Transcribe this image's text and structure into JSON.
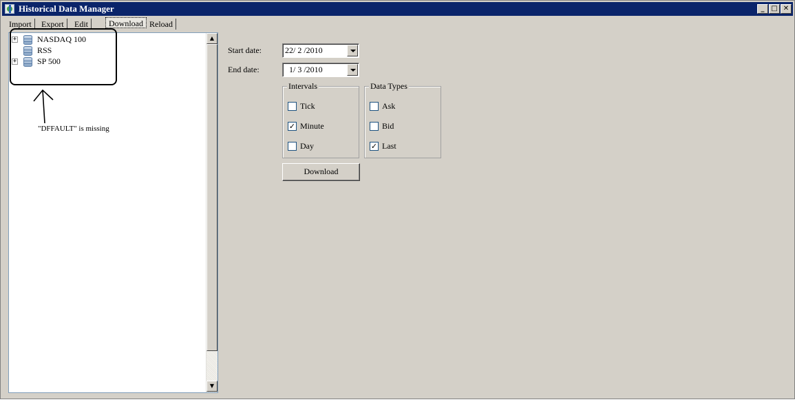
{
  "window": {
    "title": "Historical Data Manager",
    "caption_buttons": {
      "minimize": "_",
      "maximize": "□",
      "close": "✕"
    }
  },
  "menu": {
    "items": [
      {
        "label": "Import"
      },
      {
        "label": "Export"
      },
      {
        "label": "Edit"
      },
      {
        "label": "Download"
      },
      {
        "label": "Reload"
      }
    ],
    "active": "Download"
  },
  "tree": {
    "nodes": [
      {
        "label": "NASDAQ 100",
        "expander": "+",
        "icon": "database-icon"
      },
      {
        "label": "RSS",
        "expander": "",
        "icon": "database-icon"
      },
      {
        "label": "SP 500",
        "expander": "+",
        "icon": "database-icon"
      }
    ]
  },
  "annotation": {
    "text": "\"DFFAULT\"  is missing"
  },
  "form": {
    "start_date_label": "Start date:",
    "start_date_value": "22/ 2 /2010",
    "end_date_label": "End date:",
    "end_date_value": "1/ 3 /2010",
    "intervals": {
      "title": "Intervals",
      "options": [
        {
          "label": "Tick",
          "checked": false
        },
        {
          "label": "Minute",
          "checked": true
        },
        {
          "label": "Day",
          "checked": false
        }
      ]
    },
    "data_types": {
      "title": "Data Types",
      "options": [
        {
          "label": "Ask",
          "checked": false
        },
        {
          "label": "Bid",
          "checked": false
        },
        {
          "label": "Last",
          "checked": true
        }
      ]
    },
    "download_button": "Download",
    "check_mark": "✓"
  },
  "colors": {
    "titlebar": "#0a246a",
    "face": "#d4d0c8",
    "panel_border": "#7f9db9"
  }
}
